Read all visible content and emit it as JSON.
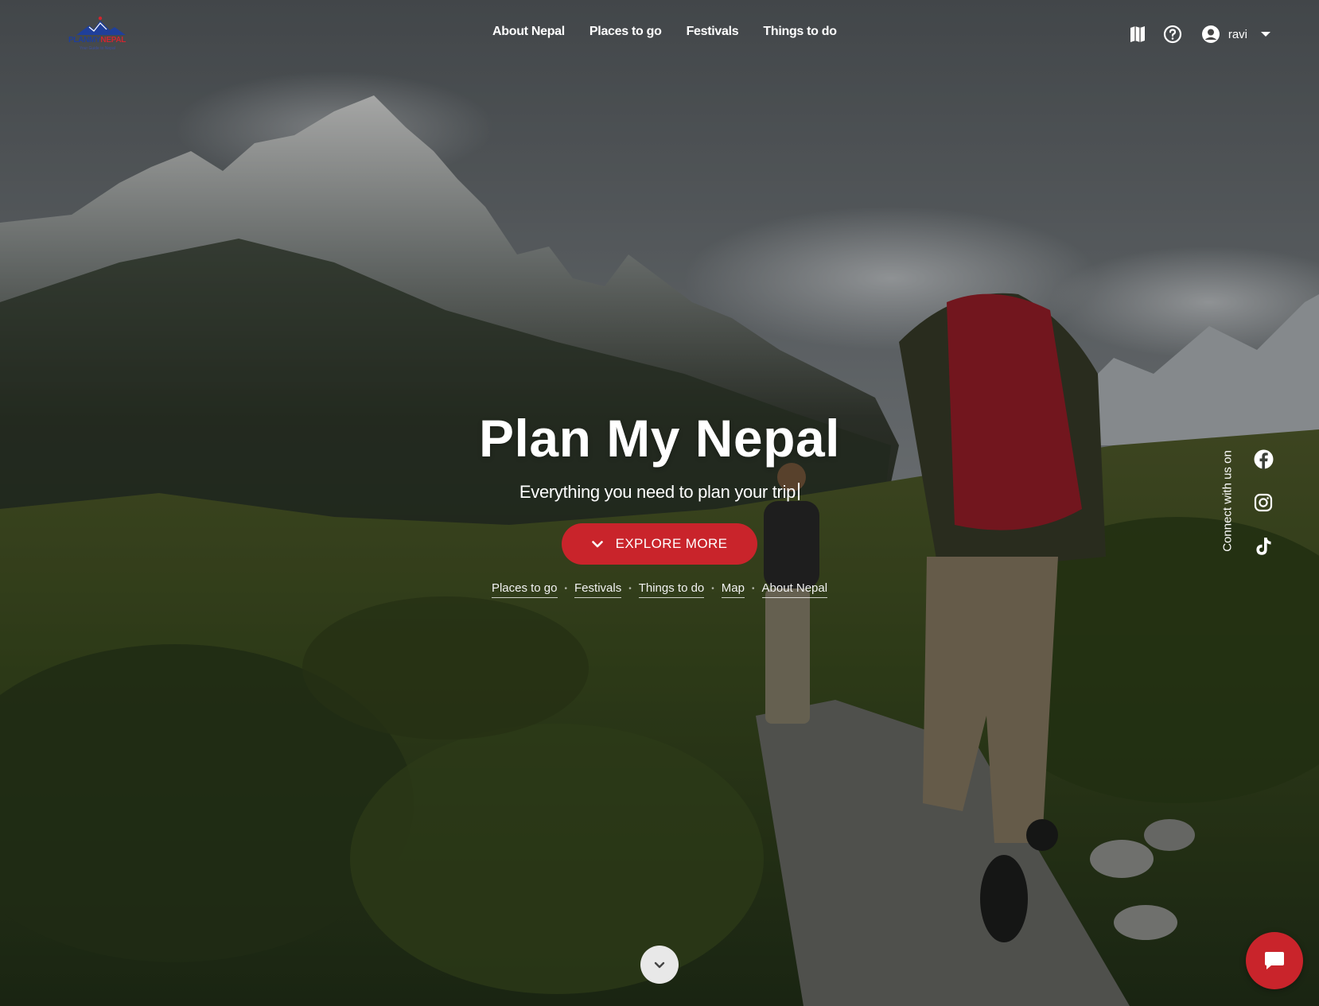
{
  "brand": {
    "logo_word_a": "PLANMY",
    "logo_word_b": "NEPAL",
    "logo_tagline": "Your Guide to Nepal"
  },
  "nav": {
    "items": [
      {
        "label": "About Nepal"
      },
      {
        "label": "Places to go"
      },
      {
        "label": "Festivals"
      },
      {
        "label": "Things to do"
      }
    ]
  },
  "header_icons": {
    "map": "map-icon",
    "help": "help-icon",
    "account": "user-circle-icon",
    "dropdown": "caret-down-icon"
  },
  "user": {
    "name": "ravi"
  },
  "hero": {
    "title": "Plan My Nepal",
    "subtitle": "Everything you need to plan your trip",
    "cta_label": "EXPLORE MORE",
    "quick_links": [
      "Places to go",
      "Festivals",
      "Things to do",
      "Map",
      "About Nepal"
    ]
  },
  "social": {
    "label": "Connect with us on",
    "networks": [
      "facebook-icon",
      "instagram-icon",
      "tiktok-icon"
    ]
  },
  "colors": {
    "accent": "#c9242b",
    "logo_blue": "#1f3f9a",
    "logo_red": "#d0262f"
  }
}
